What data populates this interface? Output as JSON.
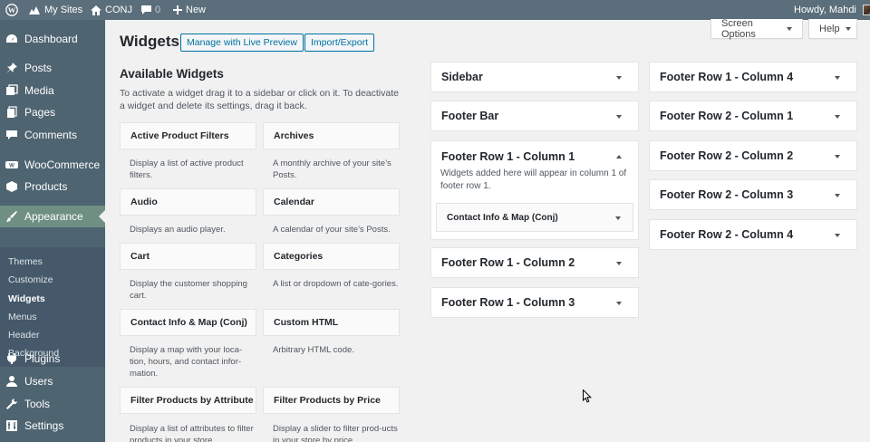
{
  "adminbar": {
    "my_sites": "My Sites",
    "site_name": "CONJ",
    "comments_count": "0",
    "new_label": "New",
    "howdy": "Howdy, Mahdi"
  },
  "menu": {
    "items": [
      {
        "label": "Dashboard",
        "icon": "dashboard-icon"
      },
      {
        "label": "Posts",
        "icon": "pin-icon"
      },
      {
        "label": "Media",
        "icon": "media-icon"
      },
      {
        "label": "Pages",
        "icon": "pages-icon"
      },
      {
        "label": "Comments",
        "icon": "comment-icon"
      },
      {
        "label": "WooCommerce",
        "icon": "woo-icon"
      },
      {
        "label": "Products",
        "icon": "box-icon"
      },
      {
        "label": "Appearance",
        "icon": "brush-icon"
      },
      {
        "label": "Plugins",
        "icon": "plug-icon"
      },
      {
        "label": "Users",
        "icon": "user-icon"
      },
      {
        "label": "Tools",
        "icon": "wrench-icon"
      },
      {
        "label": "Settings",
        "icon": "settings-icon"
      }
    ],
    "submenu": [
      "Themes",
      "Customize",
      "Widgets",
      "Menus",
      "Header",
      "Background"
    ]
  },
  "top_buttons": {
    "screen_options": "Screen Options",
    "help": "Help"
  },
  "page": {
    "title": "Widgets",
    "live_preview": "Manage with Live Preview",
    "import_export": "Import/Export"
  },
  "available": {
    "title": "Available Widgets",
    "description": "To activate a widget drag it to a sidebar or click on it. To deactivate a widget and delete its settings, drag it back.",
    "widgets": [
      {
        "name": "Active Product Filters",
        "desc": "Display a list of active product filters."
      },
      {
        "name": "Archives",
        "desc": "A monthly archive of your site’s Posts."
      },
      {
        "name": "Audio",
        "desc": "Displays an audio player."
      },
      {
        "name": "Calendar",
        "desc": "A calendar of your site’s Posts."
      },
      {
        "name": "Cart",
        "desc": "Display the customer shopping cart."
      },
      {
        "name": "Categories",
        "desc": "A list or dropdown of cate-gories."
      },
      {
        "name": "Contact Info & Map (Conj)",
        "desc": "Display a map with your loca-tion, hours, and contact infor-mation."
      },
      {
        "name": "Custom HTML",
        "desc": "Arbitrary HTML code."
      },
      {
        "name": "Filter Products by Attribute",
        "desc": "Display a list of attributes to filter products in your store."
      },
      {
        "name": "Filter Products by Price",
        "desc": "Display a slider to filter prod-ucts in your store by price."
      }
    ]
  },
  "sidebars": {
    "left": [
      {
        "name": "Sidebar"
      },
      {
        "name": "Footer Bar"
      },
      {
        "name": "Footer Row 1 - Column 1",
        "open": true,
        "desc": "Widgets added here will appear in column 1 of footer row 1.",
        "widget": "Contact Info & Map (Conj)"
      },
      {
        "name": "Footer Row 1 - Column 2"
      },
      {
        "name": "Footer Row 1 - Column 3"
      }
    ],
    "right": [
      {
        "name": "Footer Row 1 - Column 4"
      },
      {
        "name": "Footer Row 2 - Column 1"
      },
      {
        "name": "Footer Row 2 - Column 2"
      },
      {
        "name": "Footer Row 2 - Column 3"
      },
      {
        "name": "Footer Row 2 - Column 4"
      }
    ]
  },
  "colors": {
    "adminbar": "#5b6e7b",
    "menu": "#4f6471",
    "menu_current": "#6f8f83",
    "link": "#0071a1"
  }
}
